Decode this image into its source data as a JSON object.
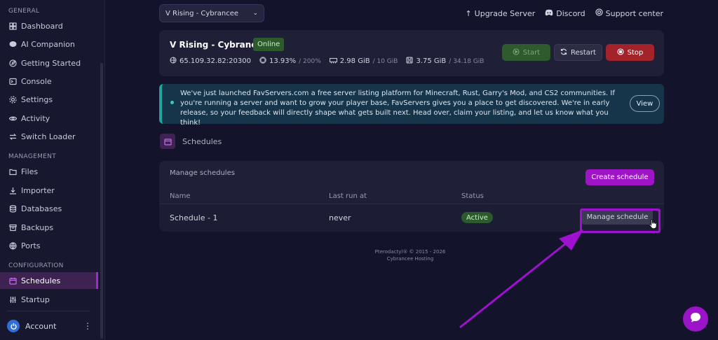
{
  "sidebar": {
    "sections": {
      "general": "GENERAL",
      "management": "MANAGEMENT",
      "configuration": "CONFIGURATION"
    },
    "items": [
      {
        "label": "Dashboard",
        "icon": "grid-icon"
      },
      {
        "label": "AI Companion",
        "icon": "chat-icon"
      },
      {
        "label": "Getting Started",
        "icon": "compass-icon"
      },
      {
        "label": "Console",
        "icon": "terminal-icon"
      },
      {
        "label": "Settings",
        "icon": "gear-icon"
      },
      {
        "label": "Activity",
        "icon": "eye-icon"
      },
      {
        "label": "Switch Loader",
        "icon": "swap-icon"
      },
      {
        "label": "Files",
        "icon": "folder-icon"
      },
      {
        "label": "Importer",
        "icon": "download-icon"
      },
      {
        "label": "Databases",
        "icon": "database-icon"
      },
      {
        "label": "Backups",
        "icon": "archive-icon"
      },
      {
        "label": "Ports",
        "icon": "network-icon"
      },
      {
        "label": "Schedules",
        "icon": "calendar-icon",
        "active": true
      },
      {
        "label": "Startup",
        "icon": "sliders-icon"
      }
    ],
    "account": {
      "label": "Account",
      "menu": "⋮"
    }
  },
  "header": {
    "server_select": "V Rising - Cybrancee",
    "links": {
      "upgrade": "Upgrade Server",
      "discord": "Discord",
      "support": "Support center"
    }
  },
  "server": {
    "name": "V Rising - Cybrancee",
    "status": "Online",
    "ip": "65.109.32.82:20300",
    "cpu": "13.93%",
    "cpu_limit": "/ 200%",
    "memory": "2.98 GiB",
    "memory_limit": "/ 10 GiB",
    "disk": "3.75 GiB",
    "disk_limit": "/ 34.18 GiB",
    "buttons": {
      "start": "Start",
      "restart": "Restart",
      "stop": "Stop"
    }
  },
  "notice": {
    "message": "We've just launched FavServers.com a free server listing platform for Minecraft, Rust, Garry's Mod, and CS2 communities. If you're running a server and want to grow your player base, FavServers gives you a place to get discovered. We're in early release, so your feedback will directly shape what gets built next. Head over, claim your listing, and let us know what you think!",
    "button": "View"
  },
  "schedules": {
    "title": "Schedules",
    "manage_label": "Manage schedules",
    "create_button": "Create schedule",
    "columns": {
      "name": "Name",
      "last_run": "Last run at",
      "status": "Status"
    },
    "rows": [
      {
        "name": "Schedule - 1",
        "last_run": "never",
        "status": "Active",
        "action": "Manage schedule"
      }
    ]
  },
  "footer": {
    "line1": "Pterodactyl® © 2015 - 2026",
    "line2": "Cybrancee Hosting"
  },
  "colors": {
    "accent": "#a014c8",
    "online": "#2d5a2c",
    "stop": "#a3232b",
    "background": "#13132b"
  }
}
